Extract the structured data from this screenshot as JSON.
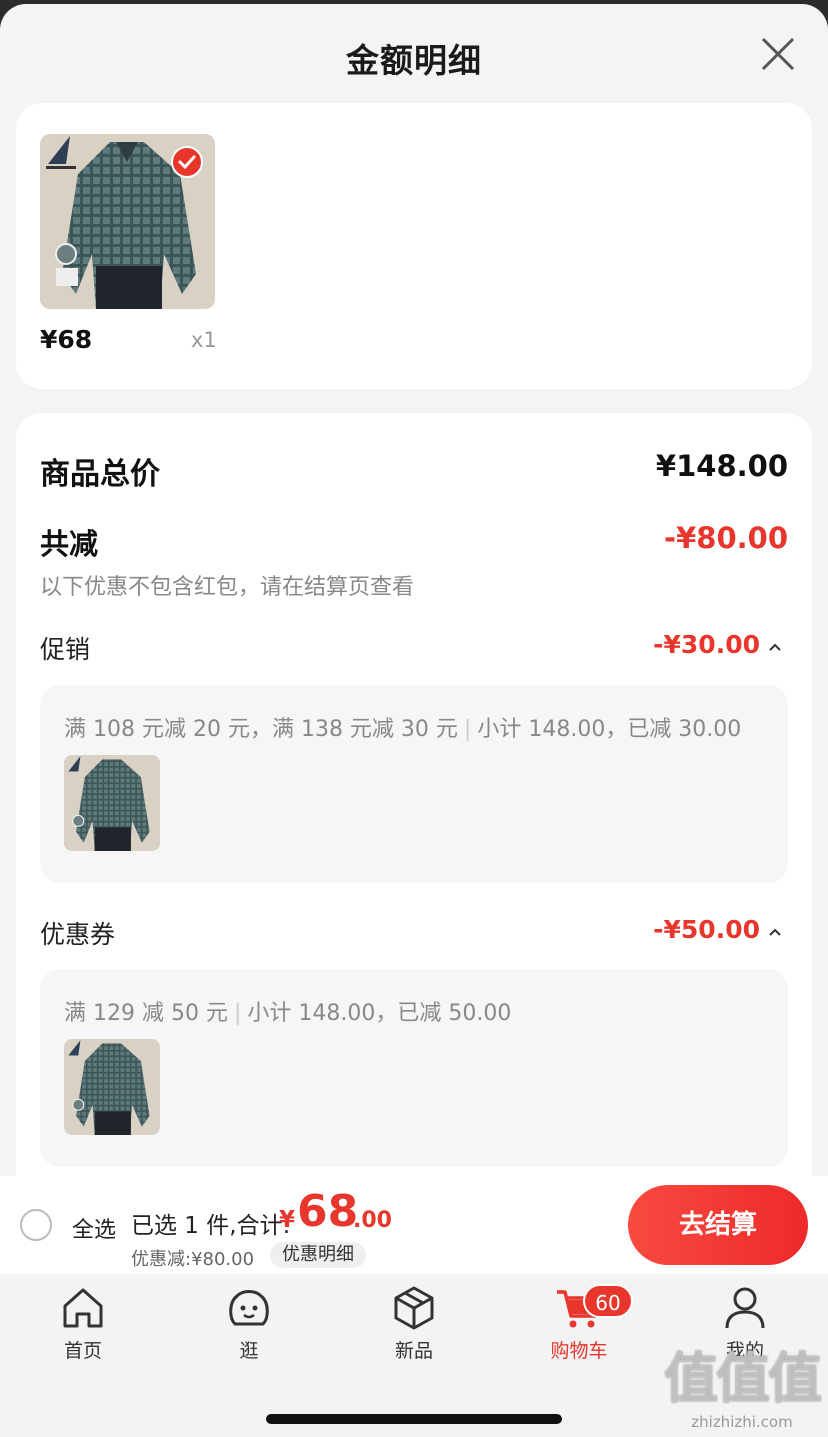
{
  "sheet": {
    "title": "金额明细"
  },
  "product": {
    "price": "¥68",
    "qty": "x1"
  },
  "detail": {
    "total_label": "商品总价",
    "total_value": "¥148.00",
    "reduce_label": "共减",
    "reduce_value": "-¥80.00",
    "reduce_note": "以下优惠不包含红包，请在结算页查看",
    "promo": {
      "label": "促销",
      "value": "-¥30.00",
      "rule": "满 108 元减 20 元，满 138 元减 30 元",
      "summary": "小计 148.00，已减 30.00"
    },
    "coupon": {
      "label": "优惠券",
      "value": "-¥50.00",
      "rule": "满 129 减 50 元",
      "summary": "小计 148.00，已减 50.00"
    }
  },
  "bottom": {
    "select_all": "全选",
    "selected_text": "已选 1 件,合计:",
    "currency": "¥",
    "total_int": "68",
    "total_dec": ".00",
    "discount": "优惠减:¥80.00",
    "detail_link": "优惠明细",
    "checkout": "去结算"
  },
  "tabs": [
    {
      "label": "首页",
      "icon": "home-icon"
    },
    {
      "label": "逛",
      "icon": "face-icon"
    },
    {
      "label": "新品",
      "icon": "cube-icon"
    },
    {
      "label": "购物车",
      "icon": "cart-icon",
      "badge": "60",
      "active": true
    },
    {
      "label": "我的",
      "icon": "user-icon"
    }
  ],
  "watermark": {
    "big": "值值值",
    "small": "zhizhizhi.com"
  },
  "colors": {
    "accent": "#e8362c",
    "background": "#f4f4f4"
  }
}
